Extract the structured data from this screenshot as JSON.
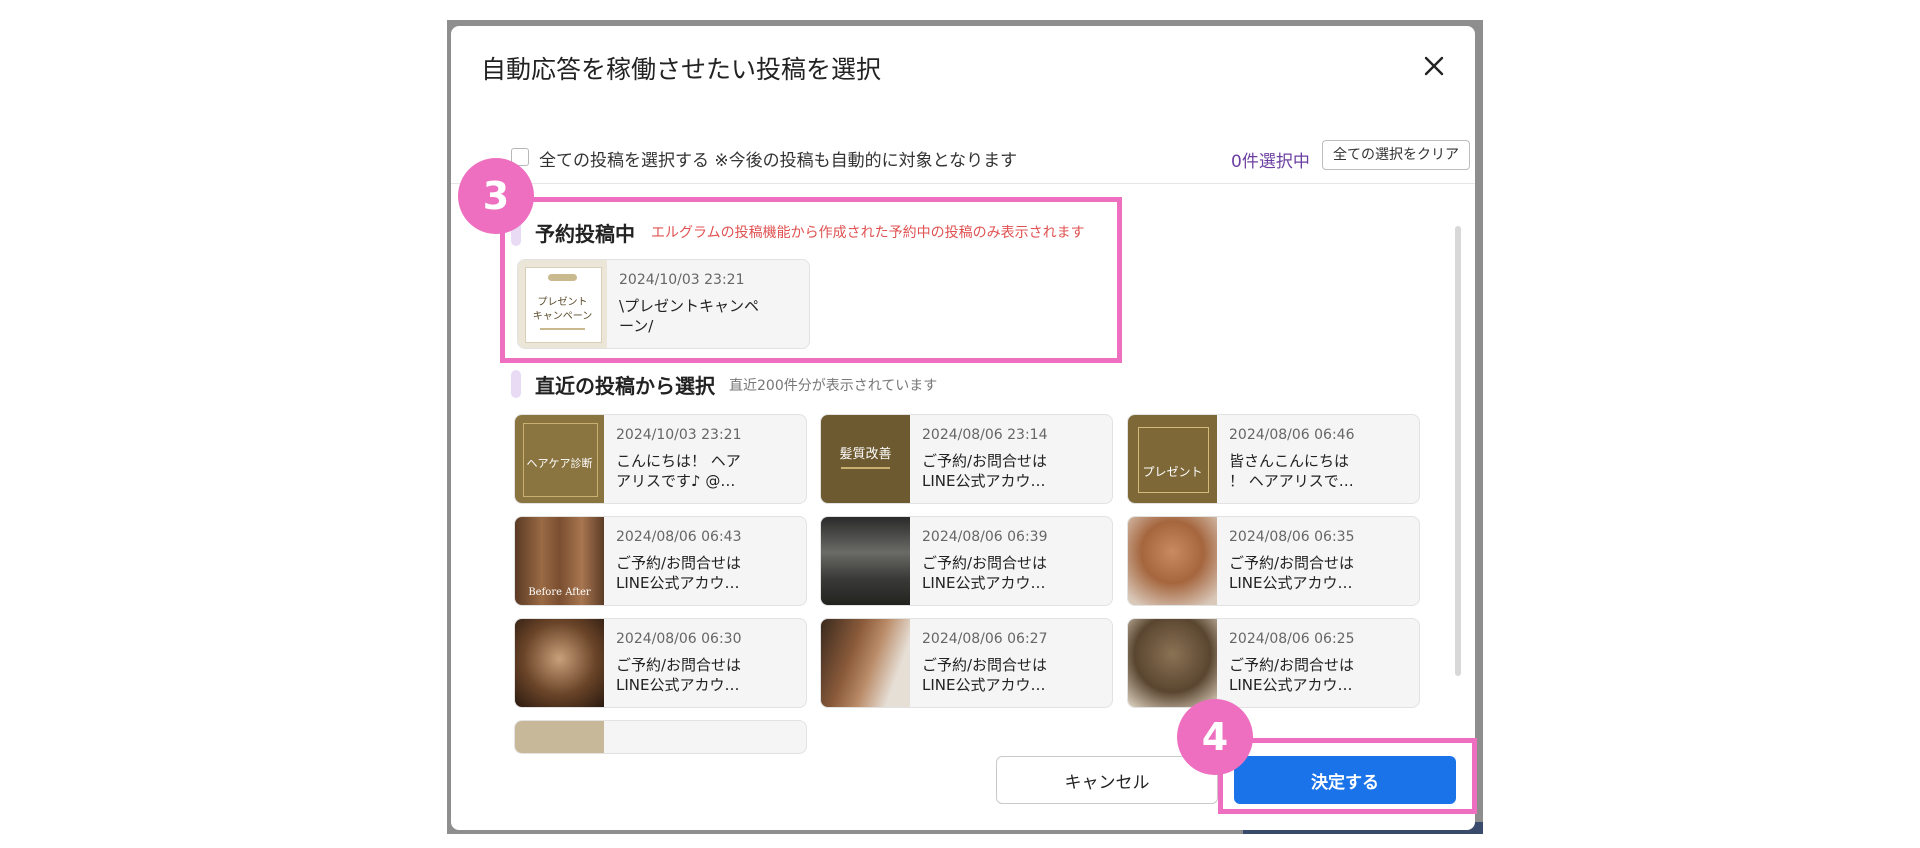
{
  "modal": {
    "title": "自動応答を稼働させたい投稿を選択",
    "select_all_label": "全ての投稿を選択する ※今後の投稿も自動的に対象となります",
    "selected_count": "0件選択中",
    "clear_button": "全ての選択をクリア"
  },
  "scheduled_section": {
    "title": "予約投稿中",
    "note": "エルグラムの投稿機能から作成された予約中の投稿のみ表示されます",
    "card": {
      "date": "2024/10/03 23:21",
      "text": "\\プレゼントキャンペ\nーン/",
      "thumb_lines": [
        "プレゼント",
        "キャンペーン"
      ]
    }
  },
  "recent_section": {
    "title": "直近の投稿から選択",
    "note": "直近200件分が表示されています",
    "cards": [
      {
        "date": "2024/10/03 23:21",
        "text": "こんにちは！ ヘア\nアリスです♪ @…",
        "thumb": "ヘアケア診断"
      },
      {
        "date": "2024/08/06 23:14",
        "text": "ご予約/お問合せは\nLINE公式アカウ…",
        "thumb": "髪質改善"
      },
      {
        "date": "2024/08/06 06:46",
        "text": "皆さんこんにちは\n！ ヘアアリスで…",
        "thumb": "プレゼント"
      },
      {
        "date": "2024/08/06 06:43",
        "text": "ご予約/お問合せは\nLINE公式アカウ…",
        "thumb": "Before After"
      },
      {
        "date": "2024/08/06 06:39",
        "text": "ご予約/お問合せは\nLINE公式アカウ…",
        "thumb": ""
      },
      {
        "date": "2024/08/06 06:35",
        "text": "ご予約/お問合せは\nLINE公式アカウ…",
        "thumb": ""
      },
      {
        "date": "2024/08/06 06:30",
        "text": "ご予約/お問合せは\nLINE公式アカウ…",
        "thumb": ""
      },
      {
        "date": "2024/08/06 06:27",
        "text": "ご予約/お問合せは\nLINE公式アカウ…",
        "thumb": ""
      },
      {
        "date": "2024/08/06 06:25",
        "text": "ご予約/お問合せは\nLINE公式アカウ…",
        "thumb": ""
      }
    ]
  },
  "footer": {
    "cancel_label": "キャンセル",
    "confirm_label": "決定する"
  },
  "annotations": {
    "step3": "3",
    "step4": "4"
  },
  "colors": {
    "accent": "#1a73e8",
    "highlight": "#ee6fc0",
    "note_red": "#e05252",
    "count_purple": "#6b3fa0"
  }
}
